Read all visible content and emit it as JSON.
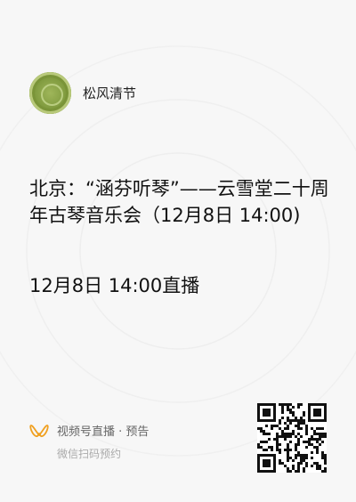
{
  "account": {
    "name": "松风清节"
  },
  "event": {
    "title": "北京：“涵芬听琴”——云雪堂二十周年古琴音乐会（12月8日 14:00)",
    "time": "12月8日 14:00直播"
  },
  "footer": {
    "live_label": "视频号直播 · 预告",
    "scan_hint": "微信扫码预约",
    "icon": "channels-icon"
  },
  "colors": {
    "accent": "#f0a020",
    "background": "#f7f7f7"
  }
}
